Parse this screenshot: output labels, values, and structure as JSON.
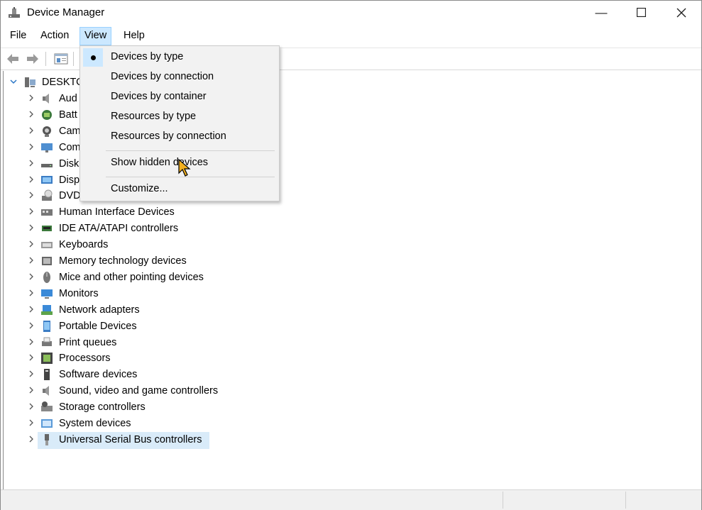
{
  "window": {
    "title": "Device Manager"
  },
  "caption": {
    "minimize": "—",
    "maximize": "☐",
    "close": "✕"
  },
  "menubar": {
    "items": [
      "File",
      "Action",
      "View",
      "Help"
    ],
    "active": "View"
  },
  "toolbar": {
    "buttons": [
      "back-icon",
      "forward-icon",
      "properties-icon"
    ]
  },
  "tree": {
    "root": {
      "label": "DESKTO",
      "expanded": true
    },
    "items": [
      {
        "label": "Aud",
        "icon": "audio-icon"
      },
      {
        "label": "Batt",
        "icon": "battery-icon"
      },
      {
        "label": "Cam",
        "icon": "camera-icon"
      },
      {
        "label": "Com",
        "icon": "computer-icon"
      },
      {
        "label": "Disk",
        "icon": "disk-icon"
      },
      {
        "label": "Disp",
        "icon": "display-icon"
      },
      {
        "label": "DVD",
        "icon": "dvd-icon"
      },
      {
        "label": "Human Interface Devices",
        "icon": "hid-icon"
      },
      {
        "label": "IDE ATA/ATAPI controllers",
        "icon": "ide-icon"
      },
      {
        "label": "Keyboards",
        "icon": "keyboard-icon"
      },
      {
        "label": "Memory technology devices",
        "icon": "memory-icon"
      },
      {
        "label": "Mice and other pointing devices",
        "icon": "mouse-icon"
      },
      {
        "label": "Monitors",
        "icon": "monitor-icon"
      },
      {
        "label": "Network adapters",
        "icon": "network-icon"
      },
      {
        "label": "Portable Devices",
        "icon": "portable-icon"
      },
      {
        "label": "Print queues",
        "icon": "printer-icon"
      },
      {
        "label": "Processors",
        "icon": "processor-icon"
      },
      {
        "label": "Software devices",
        "icon": "software-icon"
      },
      {
        "label": "Sound, video and game controllers",
        "icon": "sound-icon"
      },
      {
        "label": "Storage controllers",
        "icon": "storage-icon"
      },
      {
        "label": "System devices",
        "icon": "system-icon"
      },
      {
        "label": "Universal Serial Bus controllers",
        "icon": "usb-icon",
        "selected": true
      }
    ]
  },
  "view_menu": {
    "items": [
      {
        "label": "Devices by type",
        "checked": true
      },
      {
        "label": "Devices by connection"
      },
      {
        "label": "Devices by container"
      },
      {
        "label": "Resources by type"
      },
      {
        "label": "Resources by connection"
      },
      {
        "label": "Show hidden devices"
      },
      {
        "label": "Customize..."
      }
    ]
  },
  "colors": {
    "accent": "#cce8ff",
    "selection": "#d9ebf9",
    "chevron_root": "#2a76c6"
  }
}
